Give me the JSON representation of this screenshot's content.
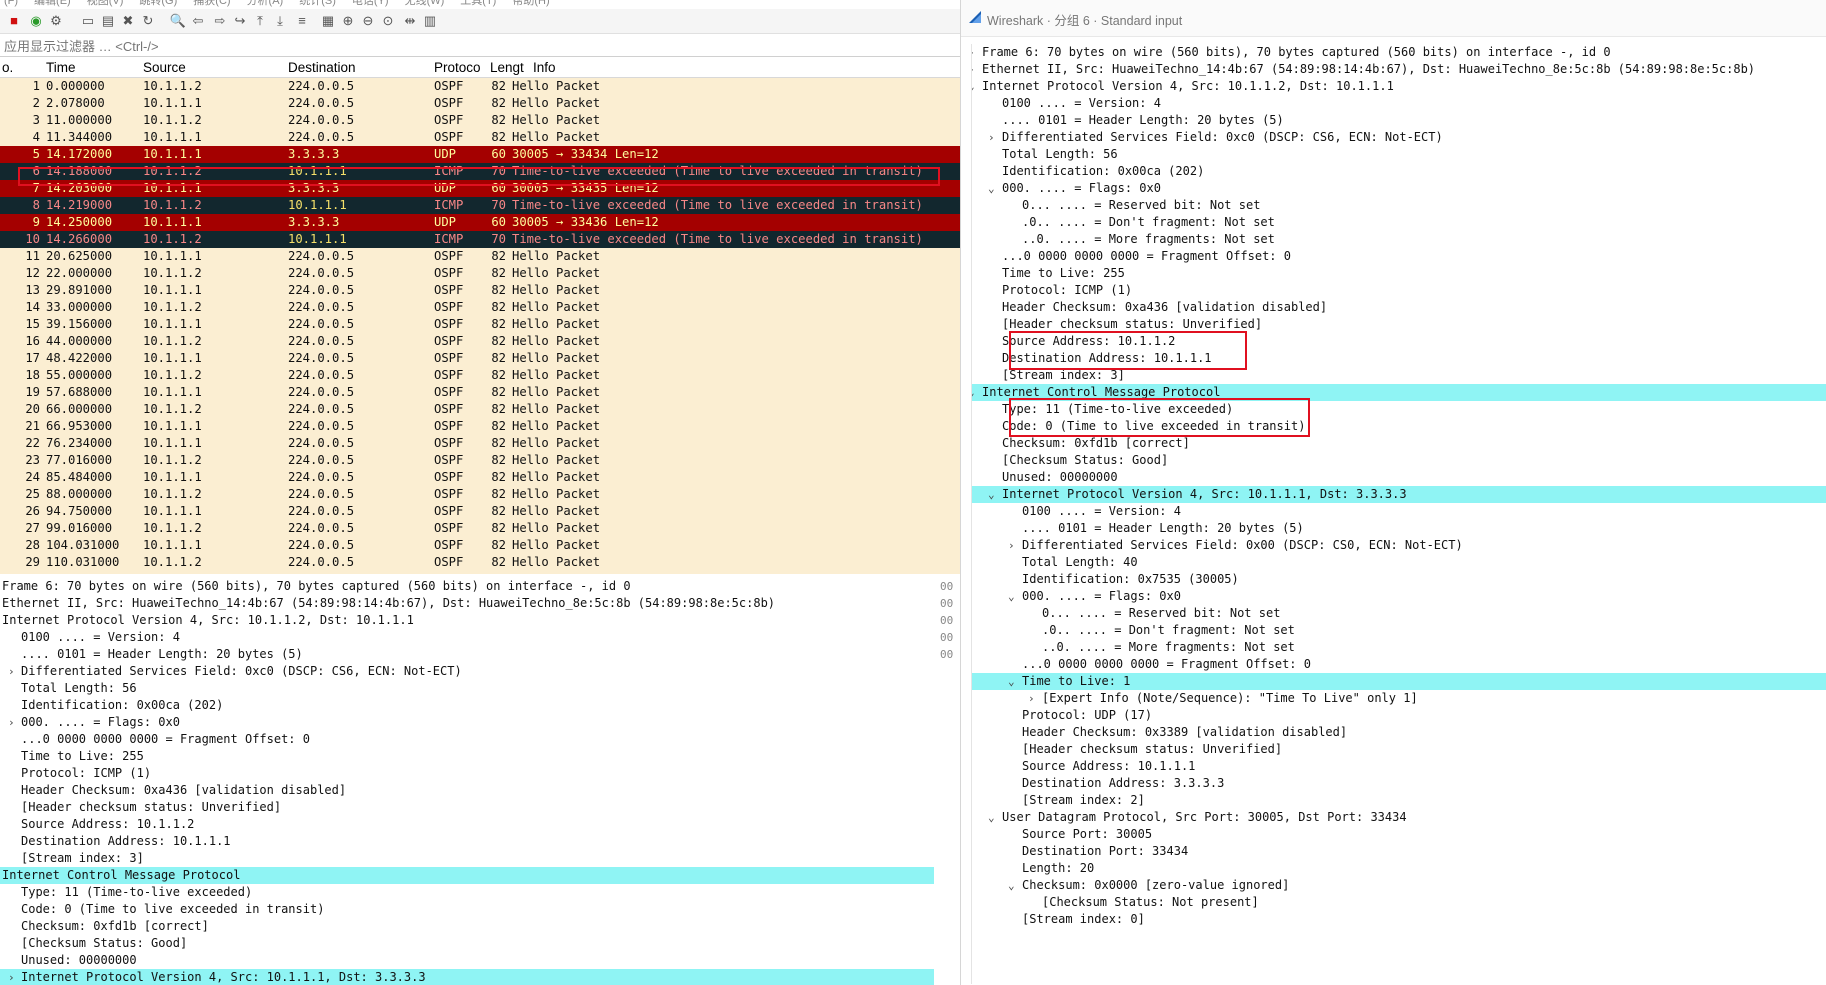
{
  "menubar": [
    "(F)",
    "编辑(E)",
    "视图(V)",
    "跳转(G)",
    "捕获(C)",
    "分析(A)",
    "统计(S)",
    "电话(Y)",
    "无线(W)",
    "工具(T)",
    "帮助(H)"
  ],
  "toolbar_icons": [
    "stop-capture-icon",
    "restart-capture-icon",
    "capture-options-icon",
    "open-file-icon",
    "save-file-icon",
    "close-file-icon",
    "reload-file-icon",
    "find-packet-icon",
    "go-back-icon",
    "go-forward-icon",
    "go-to-packet-icon",
    "go-first-icon",
    "go-last-icon",
    "auto-scroll-icon",
    "colorize-icon",
    "zoom-in-icon",
    "zoom-out-icon",
    "zoom-reset-icon",
    "resize-columns-icon",
    "layout-icon"
  ],
  "filter": {
    "placeholder": "应用显示过滤器 … <Ctrl-/>"
  },
  "packet_list": {
    "columns": [
      "o.",
      "Time",
      "Source",
      "Destination",
      "Protoco",
      "Lengt",
      "Info"
    ],
    "rows": [
      {
        "no": "1",
        "time": "0.000000",
        "src": "10.1.1.2",
        "dst": "224.0.0.5",
        "proto": "OSPF",
        "len": "82",
        "info": "Hello Packet",
        "type": "ospf"
      },
      {
        "no": "2",
        "time": "2.078000",
        "src": "10.1.1.1",
        "dst": "224.0.0.5",
        "proto": "OSPF",
        "len": "82",
        "info": "Hello Packet",
        "type": "ospf"
      },
      {
        "no": "3",
        "time": "11.000000",
        "src": "10.1.1.2",
        "dst": "224.0.0.5",
        "proto": "OSPF",
        "len": "82",
        "info": "Hello Packet",
        "type": "ospf"
      },
      {
        "no": "4",
        "time": "11.344000",
        "src": "10.1.1.1",
        "dst": "224.0.0.5",
        "proto": "OSPF",
        "len": "82",
        "info": "Hello Packet",
        "type": "ospf"
      },
      {
        "no": "5",
        "time": "14.172000",
        "src": "10.1.1.1",
        "dst": "3.3.3.3",
        "proto": "UDP",
        "len": "60",
        "info": "30005 → 33434 Len=12",
        "type": "udp"
      },
      {
        "no": "6",
        "time": "14.188000",
        "src": "10.1.1.2",
        "dst": "10.1.1.1",
        "proto": "ICMP",
        "len": "70",
        "info": "Time-to-live exceeded (Time to live exceeded in transit)",
        "type": "icmp"
      },
      {
        "no": "7",
        "time": "14.203000",
        "src": "10.1.1.1",
        "dst": "3.3.3.3",
        "proto": "UDP",
        "len": "60",
        "info": "30005 → 33435 Len=12",
        "type": "udp"
      },
      {
        "no": "8",
        "time": "14.219000",
        "src": "10.1.1.2",
        "dst": "10.1.1.1",
        "proto": "ICMP",
        "len": "70",
        "info": "Time-to-live exceeded (Time to live exceeded in transit)",
        "type": "icmp"
      },
      {
        "no": "9",
        "time": "14.250000",
        "src": "10.1.1.1",
        "dst": "3.3.3.3",
        "proto": "UDP",
        "len": "60",
        "info": "30005 → 33436 Len=12",
        "type": "udp"
      },
      {
        "no": "10",
        "time": "14.266000",
        "src": "10.1.1.2",
        "dst": "10.1.1.1",
        "proto": "ICMP",
        "len": "70",
        "info": "Time-to-live exceeded (Time to live exceeded in transit)",
        "type": "icmp"
      },
      {
        "no": "11",
        "time": "20.625000",
        "src": "10.1.1.1",
        "dst": "224.0.0.5",
        "proto": "OSPF",
        "len": "82",
        "info": "Hello Packet",
        "type": "ospf"
      },
      {
        "no": "12",
        "time": "22.000000",
        "src": "10.1.1.2",
        "dst": "224.0.0.5",
        "proto": "OSPF",
        "len": "82",
        "info": "Hello Packet",
        "type": "ospf"
      },
      {
        "no": "13",
        "time": "29.891000",
        "src": "10.1.1.1",
        "dst": "224.0.0.5",
        "proto": "OSPF",
        "len": "82",
        "info": "Hello Packet",
        "type": "ospf"
      },
      {
        "no": "14",
        "time": "33.000000",
        "src": "10.1.1.2",
        "dst": "224.0.0.5",
        "proto": "OSPF",
        "len": "82",
        "info": "Hello Packet",
        "type": "ospf"
      },
      {
        "no": "15",
        "time": "39.156000",
        "src": "10.1.1.1",
        "dst": "224.0.0.5",
        "proto": "OSPF",
        "len": "82",
        "info": "Hello Packet",
        "type": "ospf"
      },
      {
        "no": "16",
        "time": "44.000000",
        "src": "10.1.1.2",
        "dst": "224.0.0.5",
        "proto": "OSPF",
        "len": "82",
        "info": "Hello Packet",
        "type": "ospf"
      },
      {
        "no": "17",
        "time": "48.422000",
        "src": "10.1.1.1",
        "dst": "224.0.0.5",
        "proto": "OSPF",
        "len": "82",
        "info": "Hello Packet",
        "type": "ospf"
      },
      {
        "no": "18",
        "time": "55.000000",
        "src": "10.1.1.2",
        "dst": "224.0.0.5",
        "proto": "OSPF",
        "len": "82",
        "info": "Hello Packet",
        "type": "ospf"
      },
      {
        "no": "19",
        "time": "57.688000",
        "src": "10.1.1.1",
        "dst": "224.0.0.5",
        "proto": "OSPF",
        "len": "82",
        "info": "Hello Packet",
        "type": "ospf"
      },
      {
        "no": "20",
        "time": "66.000000",
        "src": "10.1.1.2",
        "dst": "224.0.0.5",
        "proto": "OSPF",
        "len": "82",
        "info": "Hello Packet",
        "type": "ospf"
      },
      {
        "no": "21",
        "time": "66.953000",
        "src": "10.1.1.1",
        "dst": "224.0.0.5",
        "proto": "OSPF",
        "len": "82",
        "info": "Hello Packet",
        "type": "ospf"
      },
      {
        "no": "22",
        "time": "76.234000",
        "src": "10.1.1.1",
        "dst": "224.0.0.5",
        "proto": "OSPF",
        "len": "82",
        "info": "Hello Packet",
        "type": "ospf"
      },
      {
        "no": "23",
        "time": "77.016000",
        "src": "10.1.1.2",
        "dst": "224.0.0.5",
        "proto": "OSPF",
        "len": "82",
        "info": "Hello Packet",
        "type": "ospf"
      },
      {
        "no": "24",
        "time": "85.484000",
        "src": "10.1.1.1",
        "dst": "224.0.0.5",
        "proto": "OSPF",
        "len": "82",
        "info": "Hello Packet",
        "type": "ospf"
      },
      {
        "no": "25",
        "time": "88.000000",
        "src": "10.1.1.2",
        "dst": "224.0.0.5",
        "proto": "OSPF",
        "len": "82",
        "info": "Hello Packet",
        "type": "ospf"
      },
      {
        "no": "26",
        "time": "94.750000",
        "src": "10.1.1.1",
        "dst": "224.0.0.5",
        "proto": "OSPF",
        "len": "82",
        "info": "Hello Packet",
        "type": "ospf"
      },
      {
        "no": "27",
        "time": "99.016000",
        "src": "10.1.1.2",
        "dst": "224.0.0.5",
        "proto": "OSPF",
        "len": "82",
        "info": "Hello Packet",
        "type": "ospf"
      },
      {
        "no": "28",
        "time": "104.031000",
        "src": "10.1.1.1",
        "dst": "224.0.0.5",
        "proto": "OSPF",
        "len": "82",
        "info": "Hello Packet",
        "type": "ospf"
      },
      {
        "no": "29",
        "time": "110.031000",
        "src": "10.1.1.2",
        "dst": "224.0.0.5",
        "proto": "OSPF",
        "len": "82",
        "info": "Hello Packet",
        "type": "ospf"
      }
    ]
  },
  "details": [
    {
      "i": 0,
      "a": "",
      "t": "Frame 6: 70 bytes on wire (560 bits), 70 bytes captured (560 bits) on interface -, id 0"
    },
    {
      "i": 0,
      "a": "",
      "t": "Ethernet II, Src: HuaweiTechno_14:4b:67 (54:89:98:14:4b:67), Dst: HuaweiTechno_8e:5c:8b (54:89:98:8e:5c:8b)"
    },
    {
      "i": 0,
      "a": "",
      "t": "Internet Protocol Version 4, Src: 10.1.1.2, Dst: 10.1.1.1"
    },
    {
      "i": 1,
      "a": "",
      "t": "0100 .... = Version: 4"
    },
    {
      "i": 1,
      "a": "",
      "t": ".... 0101 = Header Length: 20 bytes (5)"
    },
    {
      "i": 1,
      "a": "›",
      "t": "Differentiated Services Field: 0xc0 (DSCP: CS6, ECN: Not-ECT)"
    },
    {
      "i": 1,
      "a": "",
      "t": "Total Length: 56"
    },
    {
      "i": 1,
      "a": "",
      "t": "Identification: 0x00ca (202)"
    },
    {
      "i": 1,
      "a": "›",
      "t": "000. .... = Flags: 0x0"
    },
    {
      "i": 1,
      "a": "",
      "t": "...0 0000 0000 0000 = Fragment Offset: 0"
    },
    {
      "i": 1,
      "a": "",
      "t": "Time to Live: 255"
    },
    {
      "i": 1,
      "a": "",
      "t": "Protocol: ICMP (1)"
    },
    {
      "i": 1,
      "a": "",
      "t": "Header Checksum: 0xa436 [validation disabled]"
    },
    {
      "i": 1,
      "a": "",
      "t": "[Header checksum status: Unverified]"
    },
    {
      "i": 1,
      "a": "",
      "t": "Source Address: 10.1.1.2"
    },
    {
      "i": 1,
      "a": "",
      "t": "Destination Address: 10.1.1.1"
    },
    {
      "i": 1,
      "a": "",
      "t": "[Stream index: 3]"
    },
    {
      "i": 0,
      "a": "",
      "t": "Internet Control Message Protocol",
      "hl": true
    },
    {
      "i": 1,
      "a": "",
      "t": "Type: 11 (Time-to-live exceeded)"
    },
    {
      "i": 1,
      "a": "",
      "t": "Code: 0 (Time to live exceeded in transit)"
    },
    {
      "i": 1,
      "a": "",
      "t": "Checksum: 0xfd1b [correct]"
    },
    {
      "i": 1,
      "a": "",
      "t": "[Checksum Status: Good]"
    },
    {
      "i": 1,
      "a": "",
      "t": "Unused: 00000000"
    },
    {
      "i": 1,
      "a": "›",
      "t": "Internet Protocol Version 4, Src: 10.1.1.1, Dst: 3.3.3.3",
      "hl": true
    }
  ],
  "bytes_pane": [
    "00",
    "00",
    "00",
    "00",
    "00"
  ],
  "window": {
    "title": "Wireshark · 分组 6 · Standard input",
    "tree": [
      {
        "i": 0,
        "a": "›",
        "t": "Frame 6: 70 bytes on wire (560 bits), 70 bytes captured (560 bits) on interface -, id 0"
      },
      {
        "i": 0,
        "a": "›",
        "t": "Ethernet II, Src: HuaweiTechno_14:4b:67 (54:89:98:14:4b:67), Dst: HuaweiTechno_8e:5c:8b (54:89:98:8e:5c:8b)"
      },
      {
        "i": 0,
        "a": "⌄",
        "t": "Internet Protocol Version 4, Src: 10.1.1.2, Dst: 10.1.1.1"
      },
      {
        "i": 1,
        "a": "",
        "t": "0100 .... = Version: 4"
      },
      {
        "i": 1,
        "a": "",
        "t": ".... 0101 = Header Length: 20 bytes (5)"
      },
      {
        "i": 1,
        "a": "›",
        "t": "Differentiated Services Field: 0xc0 (DSCP: CS6, ECN: Not-ECT)"
      },
      {
        "i": 1,
        "a": "",
        "t": "Total Length: 56"
      },
      {
        "i": 1,
        "a": "",
        "t": "Identification: 0x00ca (202)"
      },
      {
        "i": 1,
        "a": "⌄",
        "t": "000. .... = Flags: 0x0"
      },
      {
        "i": 2,
        "a": "",
        "t": "0... .... = Reserved bit: Not set"
      },
      {
        "i": 2,
        "a": "",
        "t": ".0.. .... = Don't fragment: Not set"
      },
      {
        "i": 2,
        "a": "",
        "t": "..0. .... = More fragments: Not set"
      },
      {
        "i": 1,
        "a": "",
        "t": "...0 0000 0000 0000 = Fragment Offset: 0"
      },
      {
        "i": 1,
        "a": "",
        "t": "Time to Live: 255"
      },
      {
        "i": 1,
        "a": "",
        "t": "Protocol: ICMP (1)"
      },
      {
        "i": 1,
        "a": "",
        "t": "Header Checksum: 0xa436 [validation disabled]"
      },
      {
        "i": 1,
        "a": "",
        "t": "[Header checksum status: Unverified]"
      },
      {
        "i": 1,
        "a": "",
        "t": "Source Address: 10.1.1.2"
      },
      {
        "i": 1,
        "a": "",
        "t": "Destination Address: 10.1.1.1"
      },
      {
        "i": 1,
        "a": "",
        "t": "[Stream index: 3]"
      },
      {
        "i": 0,
        "a": "⌄",
        "t": "Internet Control Message Protocol",
        "hl": true
      },
      {
        "i": 1,
        "a": "",
        "t": "Type: 11 (Time-to-live exceeded)"
      },
      {
        "i": 1,
        "a": "",
        "t": "Code: 0 (Time to live exceeded in transit)"
      },
      {
        "i": 1,
        "a": "",
        "t": "Checksum: 0xfd1b [correct]"
      },
      {
        "i": 1,
        "a": "",
        "t": "[Checksum Status: Good]"
      },
      {
        "i": 1,
        "a": "",
        "t": "Unused: 00000000"
      },
      {
        "i": 1,
        "a": "⌄",
        "t": "Internet Protocol Version 4, Src: 10.1.1.1, Dst: 3.3.3.3",
        "hl": true
      },
      {
        "i": 2,
        "a": "",
        "t": "0100 .... = Version: 4"
      },
      {
        "i": 2,
        "a": "",
        "t": ".... 0101 = Header Length: 20 bytes (5)"
      },
      {
        "i": 2,
        "a": "›",
        "t": "Differentiated Services Field: 0x00 (DSCP: CS0, ECN: Not-ECT)"
      },
      {
        "i": 2,
        "a": "",
        "t": "Total Length: 40"
      },
      {
        "i": 2,
        "a": "",
        "t": "Identification: 0x7535 (30005)"
      },
      {
        "i": 2,
        "a": "⌄",
        "t": "000. .... = Flags: 0x0"
      },
      {
        "i": 3,
        "a": "",
        "t": "0... .... = Reserved bit: Not set"
      },
      {
        "i": 3,
        "a": "",
        "t": ".0.. .... = Don't fragment: Not set"
      },
      {
        "i": 3,
        "a": "",
        "t": "..0. .... = More fragments: Not set"
      },
      {
        "i": 2,
        "a": "",
        "t": "...0 0000 0000 0000 = Fragment Offset: 0"
      },
      {
        "i": 2,
        "a": "⌄",
        "t": "Time to Live: 1",
        "hl": true
      },
      {
        "i": 3,
        "a": "›",
        "t": "[Expert Info (Note/Sequence): \"Time To Live\" only 1]"
      },
      {
        "i": 2,
        "a": "",
        "t": "Protocol: UDP (17)"
      },
      {
        "i": 2,
        "a": "",
        "t": "Header Checksum: 0x3389 [validation disabled]"
      },
      {
        "i": 2,
        "a": "",
        "t": "[Header checksum status: Unverified]"
      },
      {
        "i": 2,
        "a": "",
        "t": "Source Address: 10.1.1.1"
      },
      {
        "i": 2,
        "a": "",
        "t": "Destination Address: 3.3.3.3"
      },
      {
        "i": 2,
        "a": "",
        "t": "[Stream index: 2]"
      },
      {
        "i": 1,
        "a": "⌄",
        "t": "User Datagram Protocol, Src Port: 30005, Dst Port: 33434"
      },
      {
        "i": 2,
        "a": "",
        "t": "Source Port: 30005"
      },
      {
        "i": 2,
        "a": "",
        "t": "Destination Port: 33434"
      },
      {
        "i": 2,
        "a": "",
        "t": "Length: 20"
      },
      {
        "i": 2,
        "a": "⌄",
        "t": "Checksum: 0x0000 [zero-value ignored]"
      },
      {
        "i": 3,
        "a": "",
        "t": "[Checksum Status: Not present]"
      },
      {
        "i": 2,
        "a": "",
        "t": "[Stream index: 0]"
      }
    ]
  },
  "colors": {
    "ospf_bg": "#fbeed2",
    "udp_bg": "#a40000",
    "udp_fg": "#fffc9c",
    "icmp_bg": "#12272e",
    "icmp_fg": "#f78787",
    "highlight": "#8ff4f4",
    "annotation_box": "#e01020"
  }
}
